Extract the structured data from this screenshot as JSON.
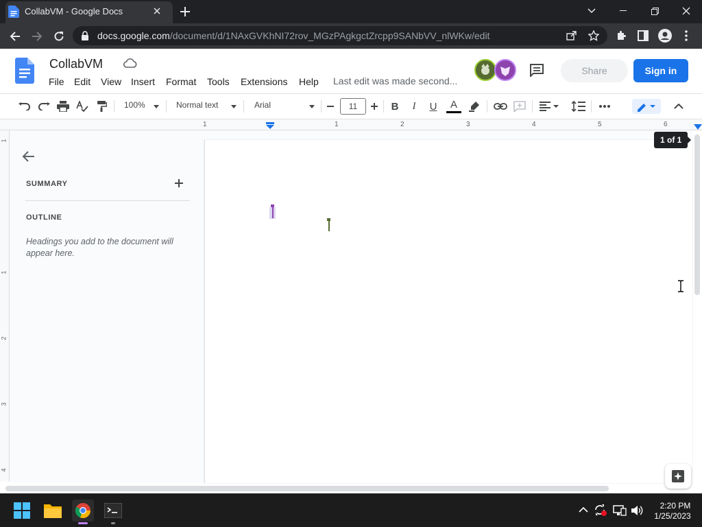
{
  "browser": {
    "tab_title": "CollabVM - Google Docs",
    "url_host": "docs.google.com",
    "url_path": "/document/d/1NAxGVKhNI72rov_MGzPAgkgctZrcpp9SANbVV_nlWKw/edit"
  },
  "docs": {
    "title": "CollabVM",
    "menu": [
      "File",
      "Edit",
      "View",
      "Insert",
      "Format",
      "Tools",
      "Extensions",
      "Help"
    ],
    "last_edit": "Last edit was made second...",
    "share_label": "Share",
    "signin_label": "Sign in"
  },
  "toolbar": {
    "zoom": "100%",
    "style": "Normal text",
    "font": "Arial",
    "font_size": "11"
  },
  "ruler": {
    "h_numbers": [
      "1",
      "1",
      "2",
      "3",
      "4",
      "5",
      "6"
    ],
    "v_numbers": [
      "1",
      "1",
      "2",
      "3",
      "4"
    ]
  },
  "outline_panel": {
    "summary_label": "SUMMARY",
    "outline_label": "OUTLINE",
    "hint": "Headings you add to the document will appear here."
  },
  "page": {
    "page_count": "1 of 1"
  },
  "taskbar": {
    "time": "2:20 PM",
    "date": "1/25/2023"
  },
  "colors": {
    "accent": "#1a73e8",
    "docs_blue": "#4285f4",
    "cursor_purple": "#8e44ad",
    "cursor_green": "#556b2f"
  }
}
